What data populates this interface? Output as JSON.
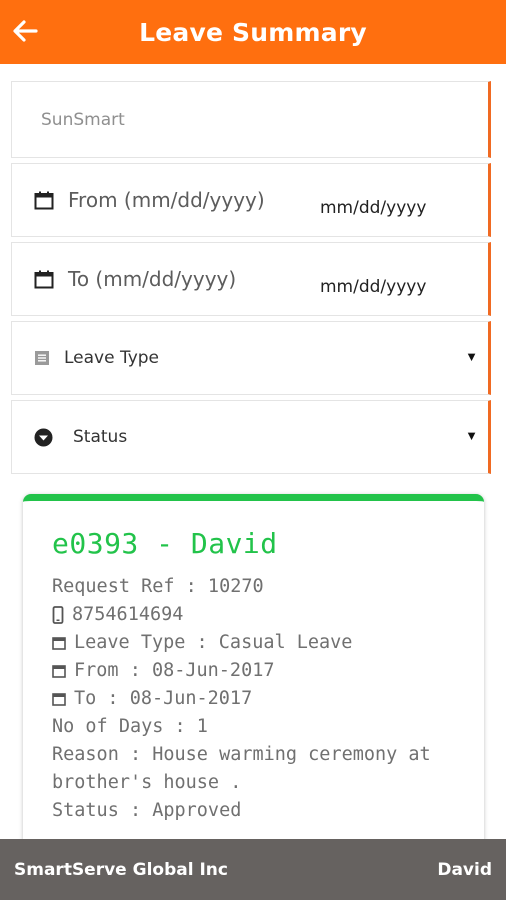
{
  "header": {
    "title": "Leave Summary",
    "back_icon": "arrow-left-icon"
  },
  "filters": {
    "company": "SunSmart",
    "from_placeholder": "From (mm/dd/yyyy)",
    "from_value": "mm/dd/yyyy",
    "to_placeholder": "To (mm/dd/yyyy)",
    "to_value": "mm/dd/yyyy",
    "leave_type_label": "Leave Type",
    "status_label": "Status"
  },
  "card": {
    "title": "e0393 - David",
    "request_ref": "Request Ref : 10270",
    "phone": "8754614694",
    "leave_type": "Leave Type : Casual Leave",
    "from": "From : 08-Jun-2017",
    "to": "To : 08-Jun-2017",
    "days": "No of Days : 1",
    "reason": "Reason : House warming ceremony at brother's house .",
    "status": "Status : Approved"
  },
  "footer": {
    "company": "SmartServe Global Inc",
    "user": "David"
  },
  "colors": {
    "header": "#ff6f0f",
    "accent": "#22c34a",
    "footer": "#666260"
  }
}
